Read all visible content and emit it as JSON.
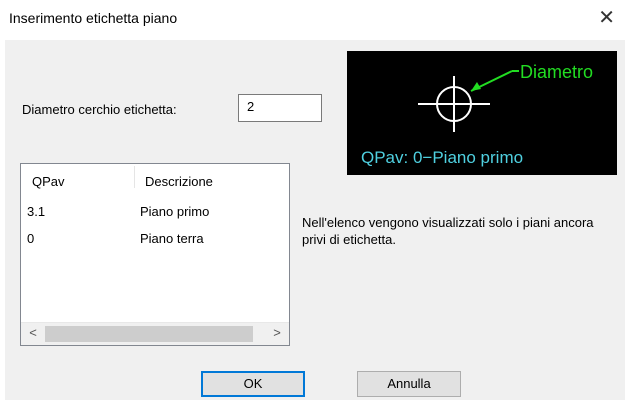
{
  "window": {
    "title": "Inserimento etichetta piano",
    "close_glyph": "✕"
  },
  "form": {
    "diameter_label": "Diametro cerchio etichetta:",
    "diameter_value": "2"
  },
  "preview": {
    "callout_label": "Diametro",
    "caption": "QPav: 0−Piano primo",
    "colors": {
      "background": "#000000",
      "symbol": "#ffffff",
      "callout": "#22dd22",
      "caption": "#4fd0e0"
    }
  },
  "list": {
    "columns": [
      "QPav",
      "Descrizione"
    ],
    "rows": [
      {
        "qpav": "3.1",
        "descrizione": "Piano primo"
      },
      {
        "qpav": "0",
        "descrizione": "Piano terra"
      }
    ],
    "scroll_left": "<",
    "scroll_right": ">"
  },
  "info_text": "Nell'elenco vengono visualizzati solo i piani ancora privi di etichetta.",
  "buttons": {
    "ok": "OK",
    "cancel": "Annulla"
  }
}
